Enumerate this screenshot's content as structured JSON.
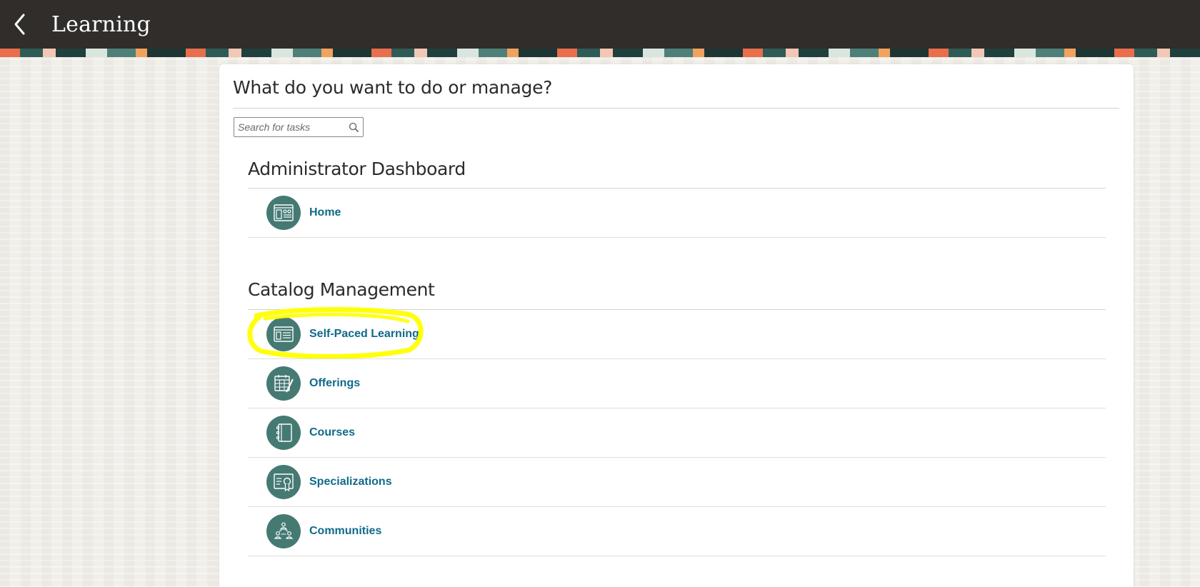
{
  "header": {
    "title": "Learning",
    "back_icon": "chevron-left-icon"
  },
  "main": {
    "question": "What do you want to do or manage?",
    "search": {
      "placeholder": "Search for tasks",
      "value": "",
      "icon": "search-icon"
    },
    "sections": [
      {
        "title": "Administrator Dashboard",
        "items": [
          {
            "label": "Home",
            "icon": "dashboard-icon"
          }
        ]
      },
      {
        "title": "Catalog Management",
        "items": [
          {
            "label": "Self-Paced Learning",
            "icon": "document-list-icon",
            "highlighted": true
          },
          {
            "label": "Offerings",
            "icon": "calendar-edit-icon"
          },
          {
            "label": "Courses",
            "icon": "notebook-icon"
          },
          {
            "label": "Specializations",
            "icon": "certificate-icon"
          },
          {
            "label": "Communities",
            "icon": "people-network-icon"
          }
        ]
      }
    ]
  },
  "colors": {
    "header_bg": "#312d2a",
    "icon_circle": "#457a73",
    "link_text": "#0f6a8a",
    "highlight": "#ffff00"
  }
}
